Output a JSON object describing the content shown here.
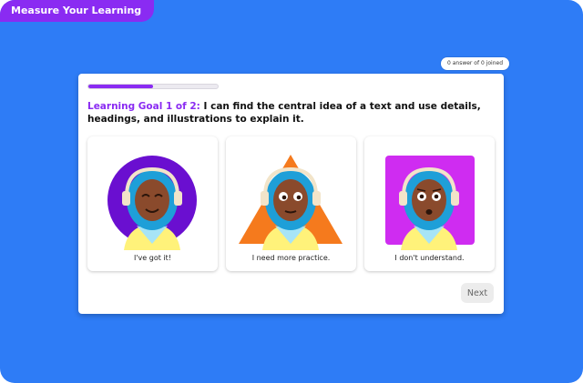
{
  "app": {
    "title": "Measure Your Learning"
  },
  "status": {
    "answers": "0 answer of 0 joined"
  },
  "progress": {
    "fraction": 0.5
  },
  "goal": {
    "prefix": "Learning Goal 1 of 2:",
    "text": " I can find the central idea of a text and use details, headings, and illustrations to explain it."
  },
  "options": [
    {
      "label": "I've got it!",
      "shape": "circle",
      "shape_color": "#6a0fd0"
    },
    {
      "label": "I need more practice.",
      "shape": "triangle",
      "shape_color": "#f57a1d"
    },
    {
      "label": "I don't understand.",
      "shape": "square",
      "shape_color": "#cf2cf1"
    }
  ],
  "actions": {
    "next": "Next"
  },
  "colors": {
    "background": "#2e7cf6",
    "accent": "#8a2bf2",
    "card": "#ffffff"
  }
}
